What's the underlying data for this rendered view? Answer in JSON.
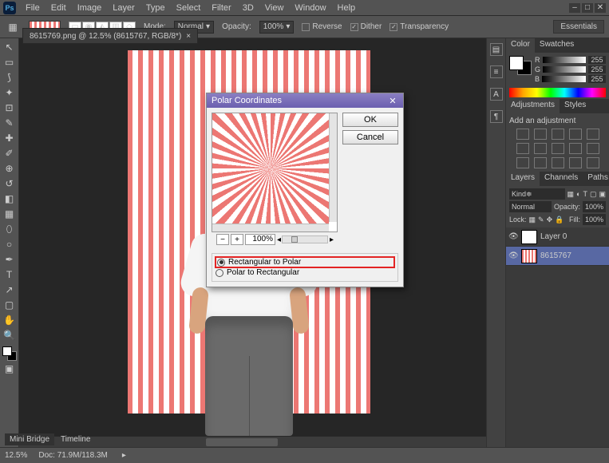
{
  "menu": [
    "File",
    "Edit",
    "Image",
    "Layer",
    "Type",
    "Select",
    "Filter",
    "3D",
    "View",
    "Window",
    "Help"
  ],
  "options_bar": {
    "mode_label": "Mode:",
    "mode_value": "Normal",
    "opacity_label": "Opacity:",
    "opacity_value": "100%",
    "reverse": "Reverse",
    "dither": "Dither",
    "transparency": "Transparency",
    "workspace": "Essentials"
  },
  "doc_tab": "8615769.png @ 12.5% (8615767, RGB/8*)",
  "status": {
    "zoom": "12.5%",
    "doc": "Doc: 71.9M/118.3M",
    "mb": "Mini Bridge",
    "tl": "Timeline"
  },
  "dialog": {
    "title": "Polar Coordinates",
    "ok": "OK",
    "cancel": "Cancel",
    "zoom": "100%",
    "opt1": "Rectangular to Polar",
    "opt2": "Polar to Rectangular"
  },
  "color": {
    "tab1": "Color",
    "tab2": "Swatches",
    "r": "R",
    "g": "G",
    "b": "B",
    "v": "255"
  },
  "adjust": {
    "tab1": "Adjustments",
    "tab2": "Styles",
    "label": "Add an adjustment"
  },
  "layers": {
    "tab1": "Layers",
    "tab2": "Channels",
    "tab3": "Paths",
    "kind": "Kind",
    "blend": "Normal",
    "op_l": "Opacity:",
    "op_v": "100%",
    "lock": "Lock:",
    "fill_l": "Fill:",
    "fill_v": "100%",
    "l0": "Layer 0",
    "l1": "8615767"
  }
}
